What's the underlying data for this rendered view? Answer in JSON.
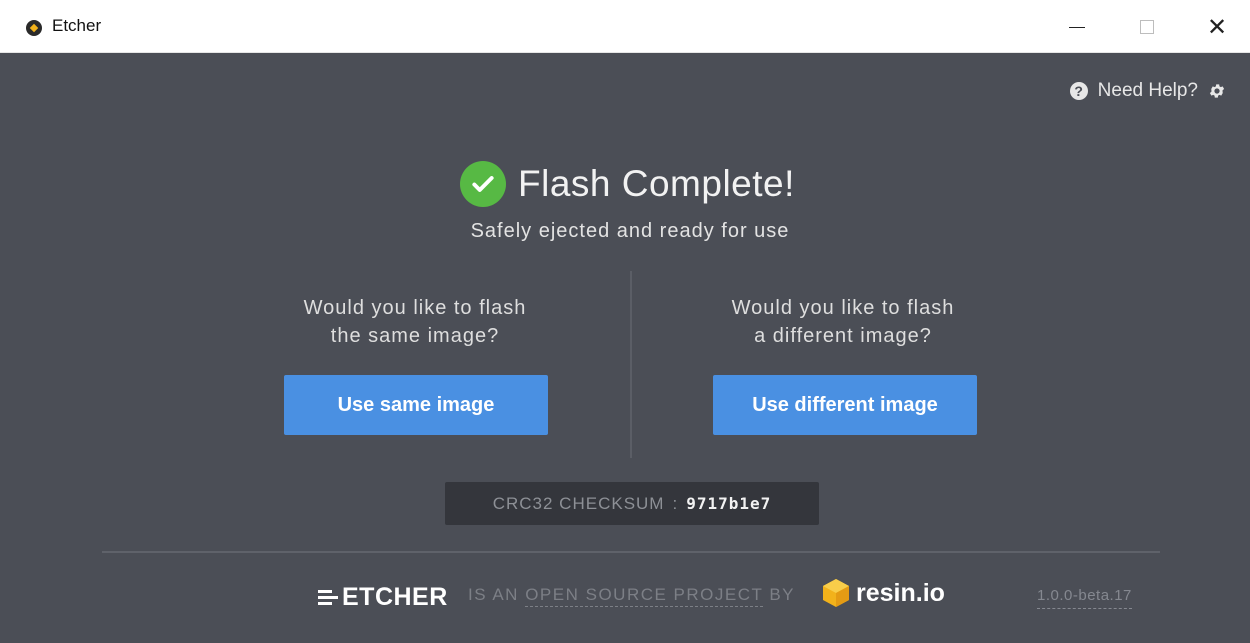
{
  "window": {
    "title": "Etcher",
    "controls": {
      "minimize": "minimize",
      "maximize": "maximize",
      "close": "close"
    }
  },
  "header": {
    "help_label": "Need Help?",
    "help_icon": "question-circle-icon",
    "settings_icon": "gear-icon"
  },
  "main": {
    "title": "Flash Complete!",
    "subtitle": "Safely ejected and ready for use",
    "left_prompt_line1": "Would you like to flash",
    "left_prompt_line2": "the same image?",
    "left_button": "Use same image",
    "right_prompt_line1": "Would you like to flash",
    "right_prompt_line2": "a different image?",
    "right_button": "Use different image",
    "checksum_label": "CRC32 CHECKSUM",
    "checksum_sep": ":",
    "checksum_value": "9717b1e7"
  },
  "footer": {
    "logo_text": "ETCHER",
    "text_prefix": "IS AN",
    "text_link": "OPEN SOURCE PROJECT",
    "text_suffix": "BY",
    "company": "resin.io",
    "version": "1.0.0-beta.17"
  },
  "colors": {
    "background": "#4b4e56",
    "accent": "#4a90e2",
    "success": "#57b944"
  }
}
